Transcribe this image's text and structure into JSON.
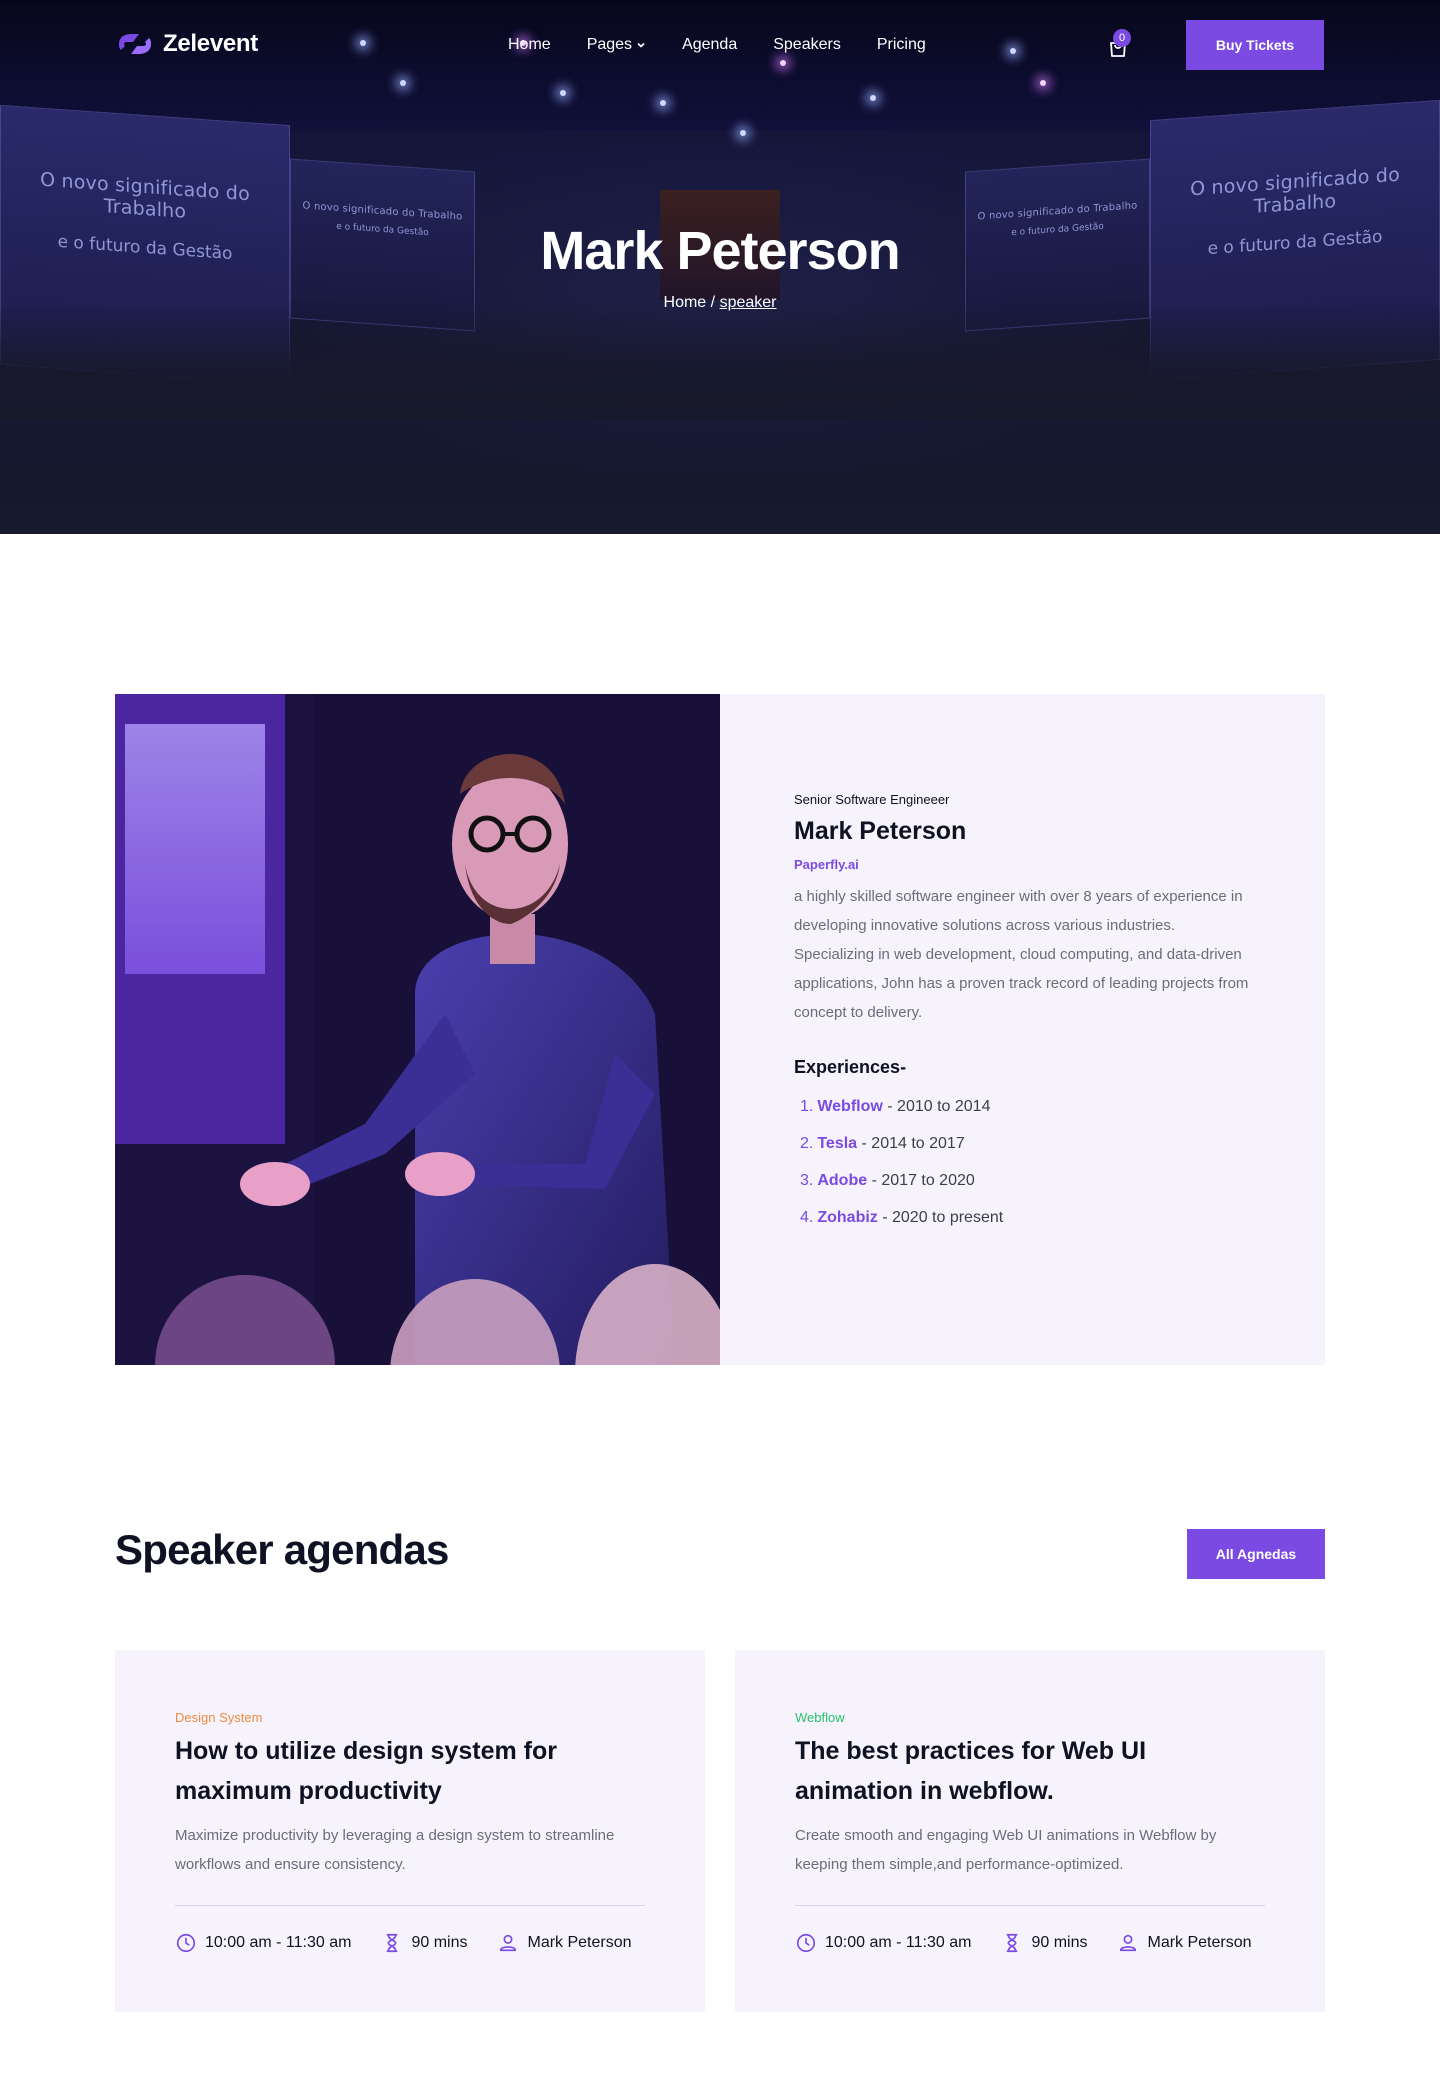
{
  "brand": {
    "name": "Zelevent"
  },
  "nav": {
    "items": [
      {
        "label": "Home"
      },
      {
        "label": "Pages",
        "has_dropdown": true
      },
      {
        "label": "Agenda"
      },
      {
        "label": "Speakers"
      },
      {
        "label": "Pricing"
      }
    ],
    "cart_count": "0",
    "cta_label": "Buy Tickets"
  },
  "hero": {
    "title": "Mark Peterson",
    "breadcrumb": {
      "home": "Home",
      "separator": "/",
      "current": "speaker"
    },
    "screen_left_line1": "O novo significado do Trabalho",
    "screen_left_line2": "e o futuro da Gestão",
    "screen_right_line1": "O novo significado do Trabalho",
    "screen_right_line2": "e o futuro da Gestão"
  },
  "speaker": {
    "role": "Senior Software Engineeer",
    "name": "Mark Peterson",
    "company": "Paperfly.ai",
    "bio": "a highly skilled software engineer with over 8 years of experience in developing innovative solutions across various industries. Specializing in web development, cloud computing, and data-driven applications, John has a proven track record of leading projects from concept to delivery.",
    "experience_title": "Experiences-",
    "experiences": [
      {
        "num": "1.",
        "company": "Webflow",
        "period": " - 2010 to 2014"
      },
      {
        "num": "2.",
        "company": "Tesla",
        "period": " - 2014 to 2017"
      },
      {
        "num": "3.",
        "company": "Adobe",
        "period": " - 2017 to 2020"
      },
      {
        "num": "4.",
        "company": "Zohabiz",
        "period": " - 2020 to present"
      }
    ]
  },
  "agendas": {
    "title": "Speaker agendas",
    "all_button": "All Agnedas",
    "cards": [
      {
        "tag": "Design System",
        "title": "How to utilize design system for maximum productivity",
        "desc": "Maximize productivity by leveraging a design system to streamline workflows and ensure consistency.",
        "time": "10:00 am - 11:30 am",
        "duration": "90 mins",
        "speaker": "Mark Peterson"
      },
      {
        "tag": "Webflow",
        "title": "The best practices for Web UI animation in webflow.",
        "desc": "Create smooth and engaging Web UI animations in Webflow by keeping them simple,and performance-optimized.",
        "time": "10:00 am - 11:30 am",
        "duration": "90 mins",
        "speaker": "Mark Peterson"
      }
    ]
  },
  "colors": {
    "accent": "#7b4ae2",
    "tag_orange": "#f08a3e",
    "tag_green": "#27c26a",
    "card_bg": "#f6f3fd",
    "hero_bg": "#161a2c"
  },
  "icons": [
    "logo-icon",
    "chevron-down-icon",
    "cart-icon",
    "clock-icon",
    "hourglass-icon",
    "user-icon"
  ]
}
